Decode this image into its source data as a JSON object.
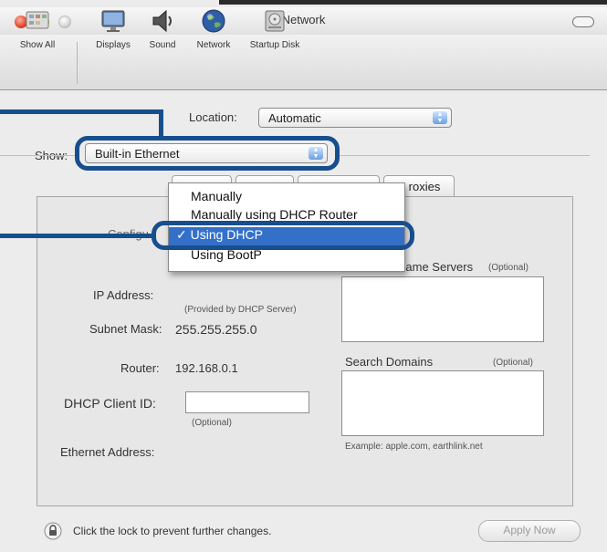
{
  "window": {
    "title": "Network"
  },
  "toolbar": {
    "items": [
      {
        "label": "Show All",
        "icon": "show-all-icon"
      },
      {
        "label": "Displays",
        "icon": "displays-icon"
      },
      {
        "label": "Sound",
        "icon": "speaker-icon"
      },
      {
        "label": "Network",
        "icon": "globe-icon"
      },
      {
        "label": "Startup Disk",
        "icon": "disk-icon"
      }
    ]
  },
  "location": {
    "label": "Location:",
    "value": "Automatic"
  },
  "show": {
    "label": "Show:",
    "value": "Built-in Ethernet"
  },
  "tabs": {
    "visible_tab_label": "roxies"
  },
  "configure": {
    "label_partial": "Configu",
    "menu": {
      "options": [
        "Manually",
        "Manually using DHCP Router",
        "Using DHCP",
        "Using BootP"
      ],
      "selected": "Using DHCP",
      "check": "✓"
    }
  },
  "fields": {
    "ip_label": "IP Address:",
    "ip_note": "(Provided by DHCP Server)",
    "subnet_label": "Subnet Mask:",
    "subnet_value": "255.255.255.0",
    "router_label": "Router:",
    "router_value": "192.168.0.1",
    "dhcp_label": "DHCP Client ID:",
    "dhcp_value": "",
    "dhcp_note": "(Optional)",
    "ethernet_label": "Ethernet Address:"
  },
  "dns": {
    "label_visible": "Name Servers",
    "optional": "(Optional)"
  },
  "search": {
    "label": "Search Domains",
    "optional": "(Optional)",
    "example": "Example: apple.com, earthlink.net"
  },
  "footer": {
    "lock_text": "Click the lock to prevent further changes.",
    "apply_label": "Apply Now"
  },
  "colors": {
    "callout": "#174e8d",
    "selection": "#3470c8"
  }
}
